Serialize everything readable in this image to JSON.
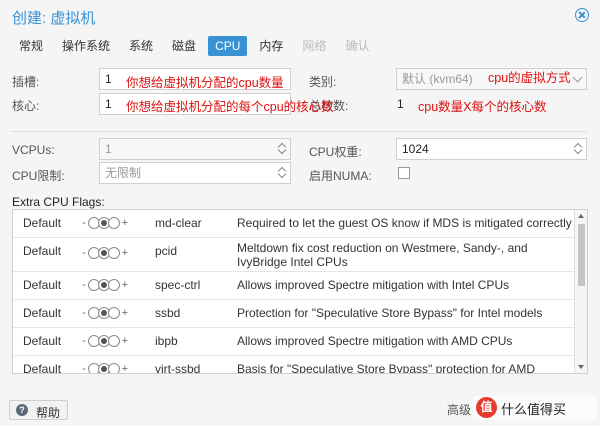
{
  "window": {
    "title": "创建: 虚拟机"
  },
  "tabs": [
    {
      "label": "常规",
      "state": "normal"
    },
    {
      "label": "操作系统",
      "state": "normal"
    },
    {
      "label": "系统",
      "state": "normal"
    },
    {
      "label": "磁盘",
      "state": "normal"
    },
    {
      "label": "CPU",
      "state": "active"
    },
    {
      "label": "内存",
      "state": "normal"
    },
    {
      "label": "网络",
      "state": "disabled"
    },
    {
      "label": "确认",
      "state": "disabled"
    }
  ],
  "cpu": {
    "sockets_label": "插槽:",
    "sockets_value": "1",
    "cores_label": "核心:",
    "cores_value": "1",
    "type_label": "类别:",
    "type_value": "默认 (kvm64)",
    "total_label": "总核数:",
    "total_value": "1",
    "vcpus_label": "VCPUs:",
    "vcpus_value": "1",
    "weight_label": "CPU权重:",
    "weight_value": "1024",
    "limit_label": "CPU限制:",
    "limit_value": "无限制",
    "numa_label": "启用NUMA:"
  },
  "annotations": {
    "sockets": "你想给虚拟机分配的cpu数量",
    "cores": "你想给虚拟机分配的每个cpu的核心数",
    "type": "cpu的虚拟方式",
    "total": "cpu数量X每个的核心数"
  },
  "flags": {
    "heading": "Extra CPU Flags:",
    "minus": "-",
    "plus": "+",
    "rows": [
      {
        "default": "Default",
        "name": "md-clear",
        "desc": "Required to let the guest OS know if MDS is mitigated correctly"
      },
      {
        "default": "Default",
        "name": "pcid",
        "desc": "Meltdown fix cost reduction on Westmere, Sandy-, and IvyBridge Intel CPUs"
      },
      {
        "default": "Default",
        "name": "spec-ctrl",
        "desc": "Allows improved Spectre mitigation with Intel CPUs"
      },
      {
        "default": "Default",
        "name": "ssbd",
        "desc": "Protection for \"Speculative Store Bypass\" for Intel models"
      },
      {
        "default": "Default",
        "name": "ibpb",
        "desc": "Allows improved Spectre mitigation with AMD CPUs"
      },
      {
        "default": "Default",
        "name": "virt-ssbd",
        "desc": "Basis for \"Speculative Store Bypass\" protection for AMD models"
      }
    ]
  },
  "footer": {
    "help_label": "帮助",
    "advanced_label": "高级"
  },
  "watermark": {
    "logo": "值",
    "text": "什么值得买"
  }
}
